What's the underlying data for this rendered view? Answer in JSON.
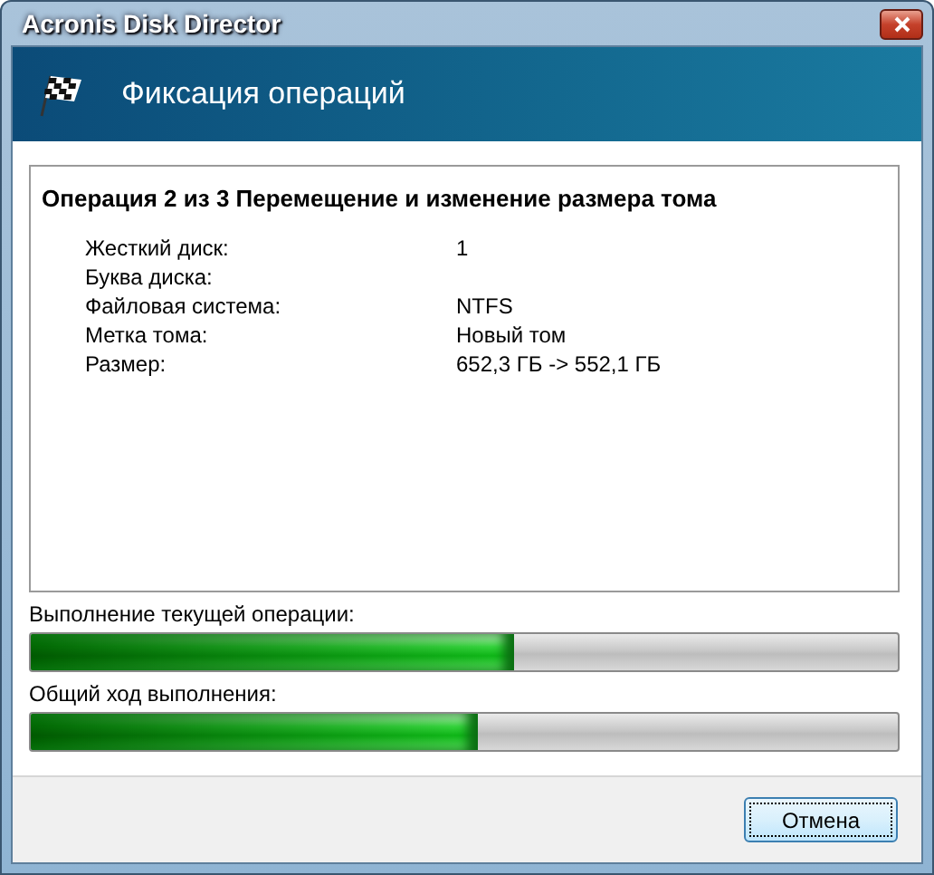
{
  "window": {
    "title": "Acronis Disk Director"
  },
  "header": {
    "title": "Фиксация операций"
  },
  "operation": {
    "title": "Операция 2 из 3 Перемещение и изменение размера тома",
    "fields": [
      {
        "label": "Жесткий диск:",
        "value": "1"
      },
      {
        "label": "Буква диска:"
      },
      {
        "label": "Файловая система:",
        "value": "NTFS"
      },
      {
        "label": "Метка тома:",
        "value": "Новый том"
      },
      {
        "label": "Размер:",
        "value": "652,3 ГБ -> 552,1 ГБ"
      }
    ]
  },
  "progress": [
    {
      "label": "Выполнение текущей операции:",
      "level": 0.557
    },
    {
      "label": "Общий ход выполнения:",
      "level": 0.515
    }
  ],
  "buttons": [
    "Отмена"
  ]
}
